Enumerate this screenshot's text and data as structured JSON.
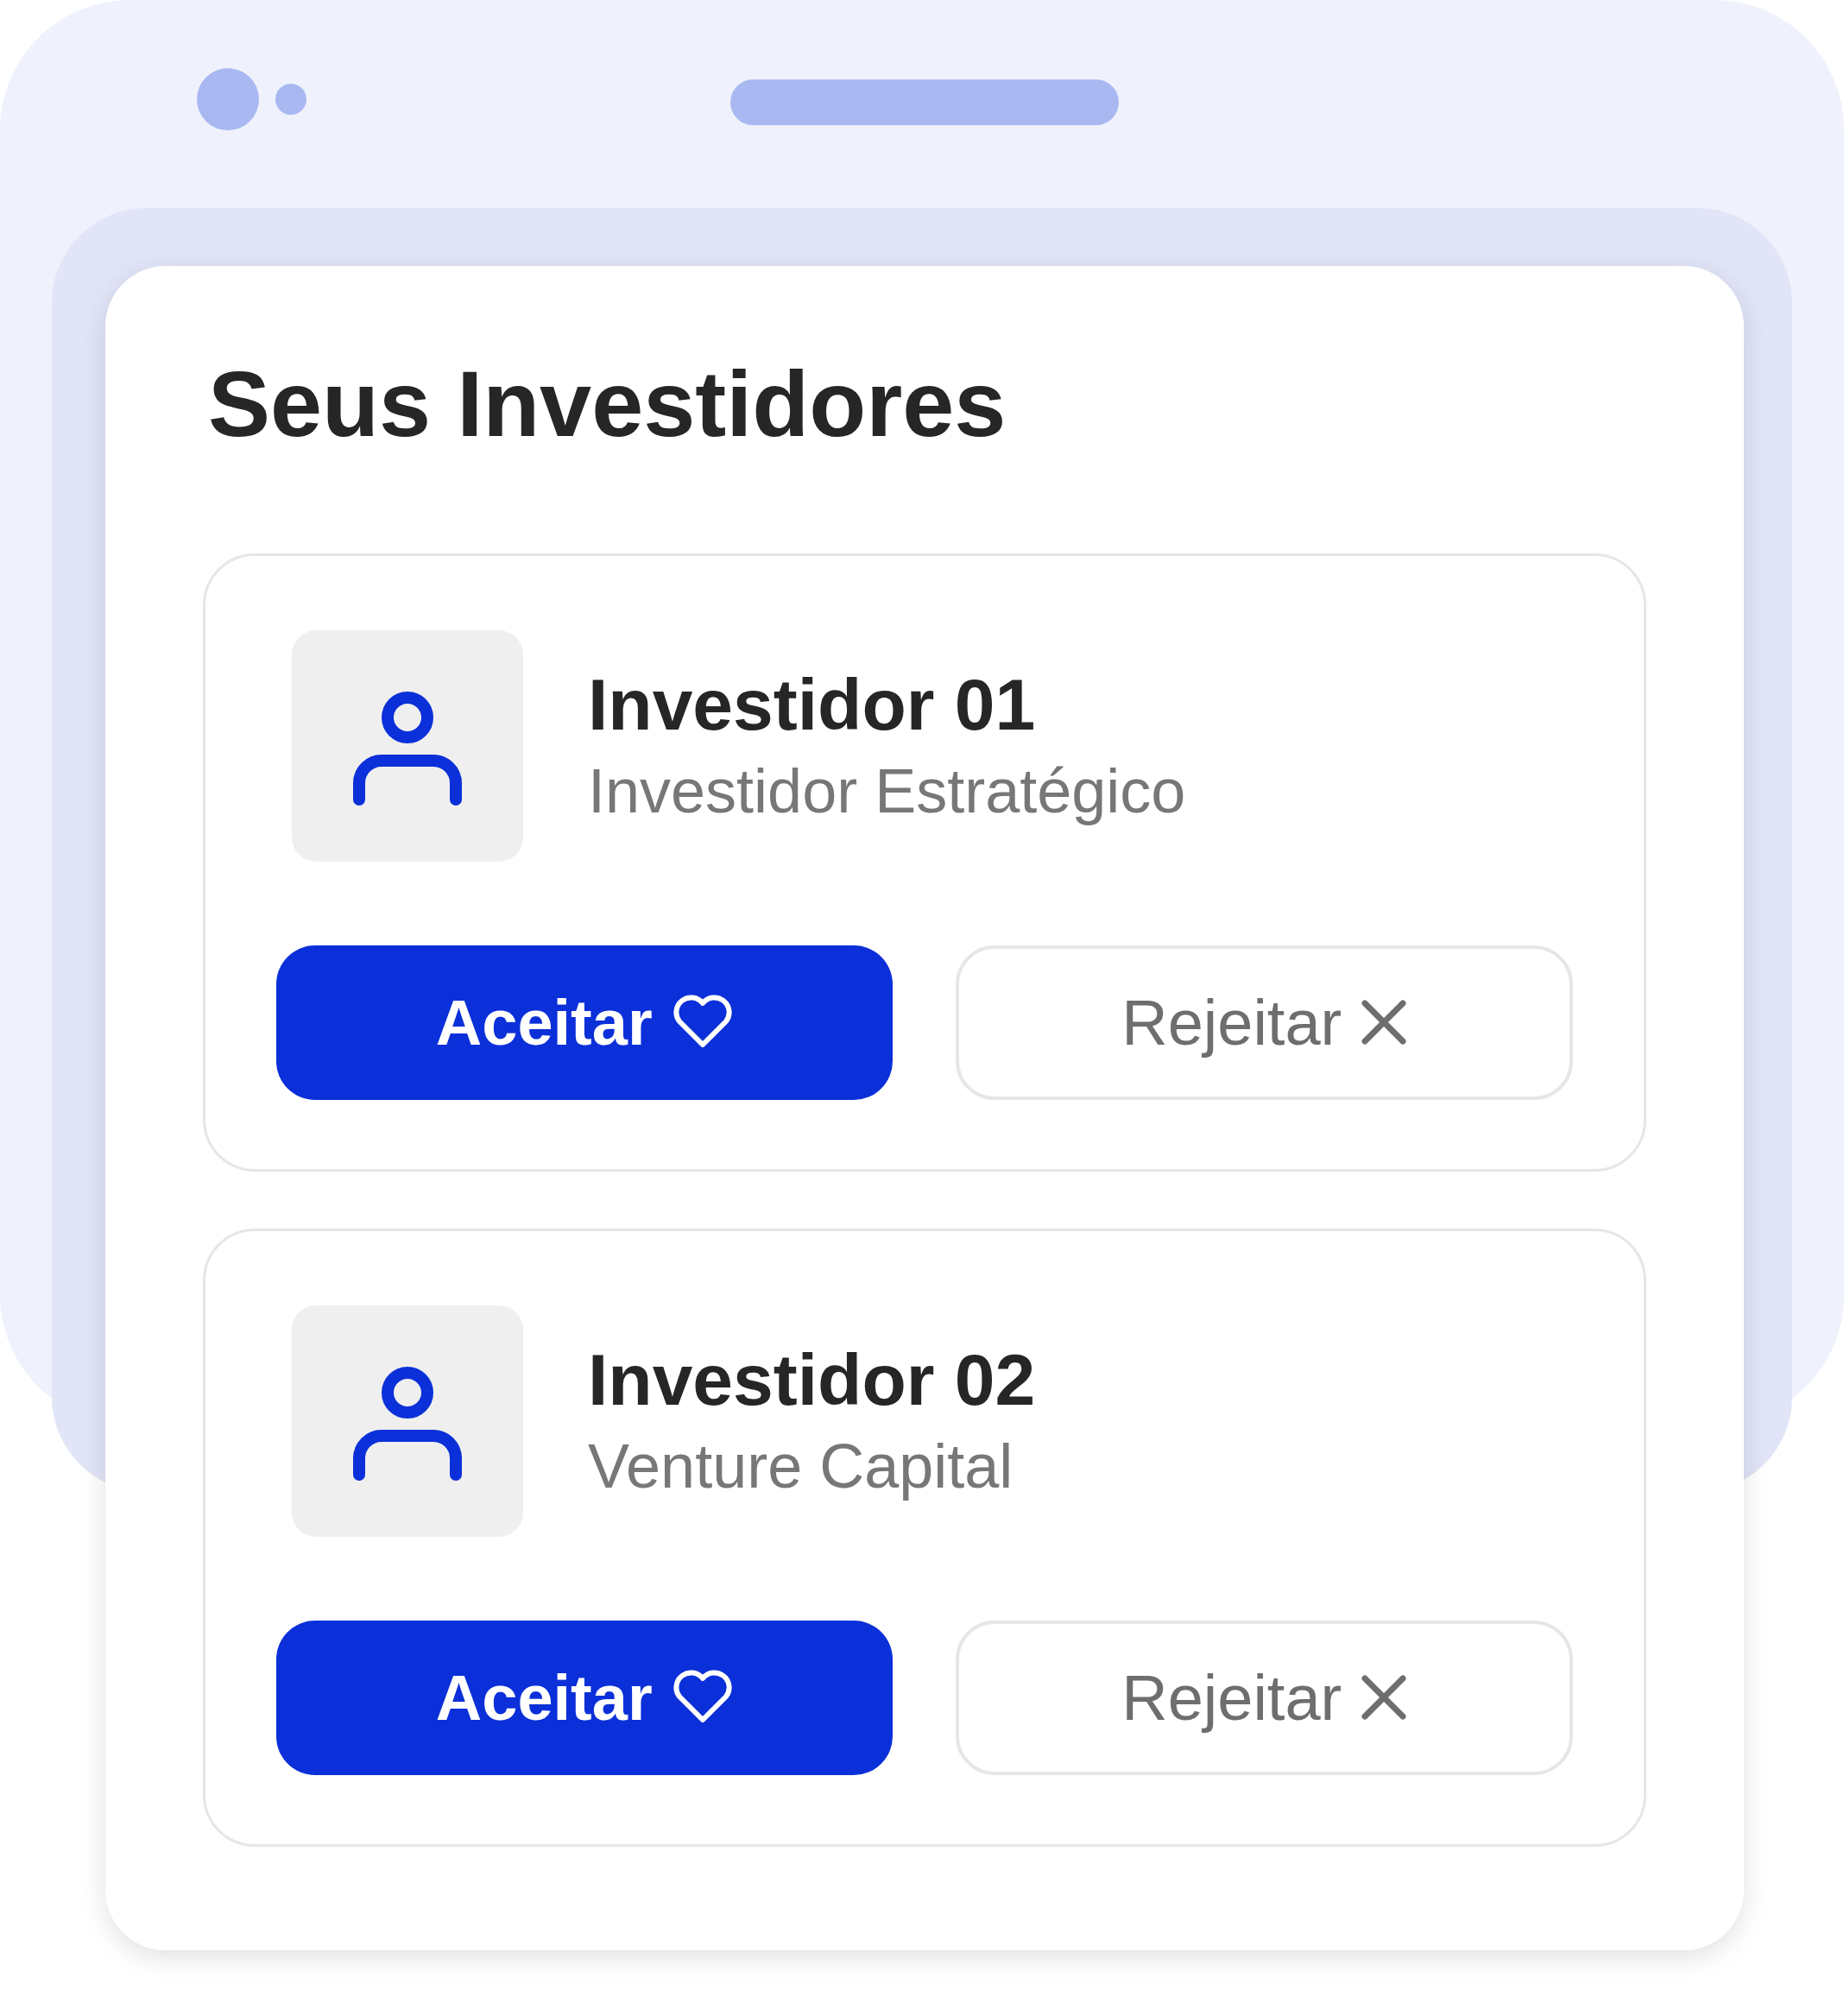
{
  "title": "Seus Investidores",
  "investors": [
    {
      "name": "Investidor 01",
      "type": "Investidor Estratégico",
      "accept": "Aceitar",
      "reject": "Rejeitar"
    },
    {
      "name": "Investidor 02",
      "type": "Venture Capital",
      "accept": "Aceitar",
      "reject": "Rejeitar"
    }
  ]
}
